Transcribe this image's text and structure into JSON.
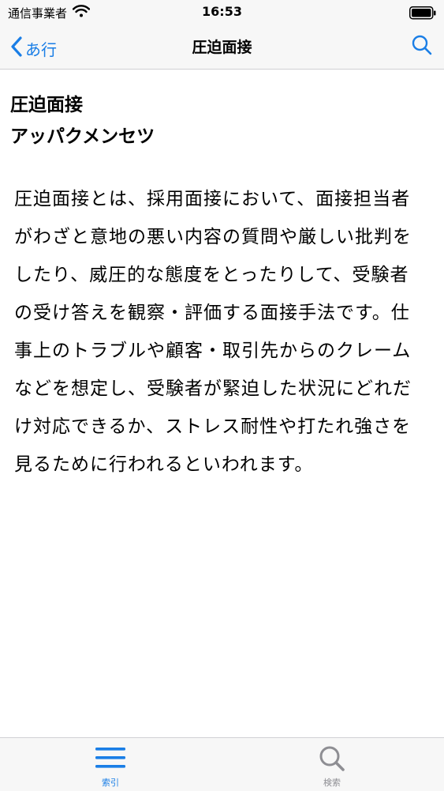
{
  "status_bar": {
    "carrier": "通信事業者",
    "time": "16:53"
  },
  "nav": {
    "back_label": "あ行",
    "title": "圧迫面接",
    "accent_color": "#1a7ee6"
  },
  "term": {
    "title": "圧迫面接",
    "reading": "アッパクメンセツ",
    "body": "圧迫面接とは、採用面接において、面接担当者がわざと意地の悪い内容の質問や厳しい批判をしたり、威圧的な態度をとったりして、受験者の受け答えを観察・評価する面接手法です。仕事上のトラブルや顧客・取引先からのクレームなどを想定し、受験者が緊迫した状況にどれだけ対応できるか、ストレス耐性や打たれ強さを見るために行われるといわれます。"
  },
  "tab_bar": {
    "tabs": [
      {
        "label": "索引",
        "icon": "list-icon",
        "selected": true
      },
      {
        "label": "検索",
        "icon": "search-icon",
        "selected": false
      }
    ]
  }
}
